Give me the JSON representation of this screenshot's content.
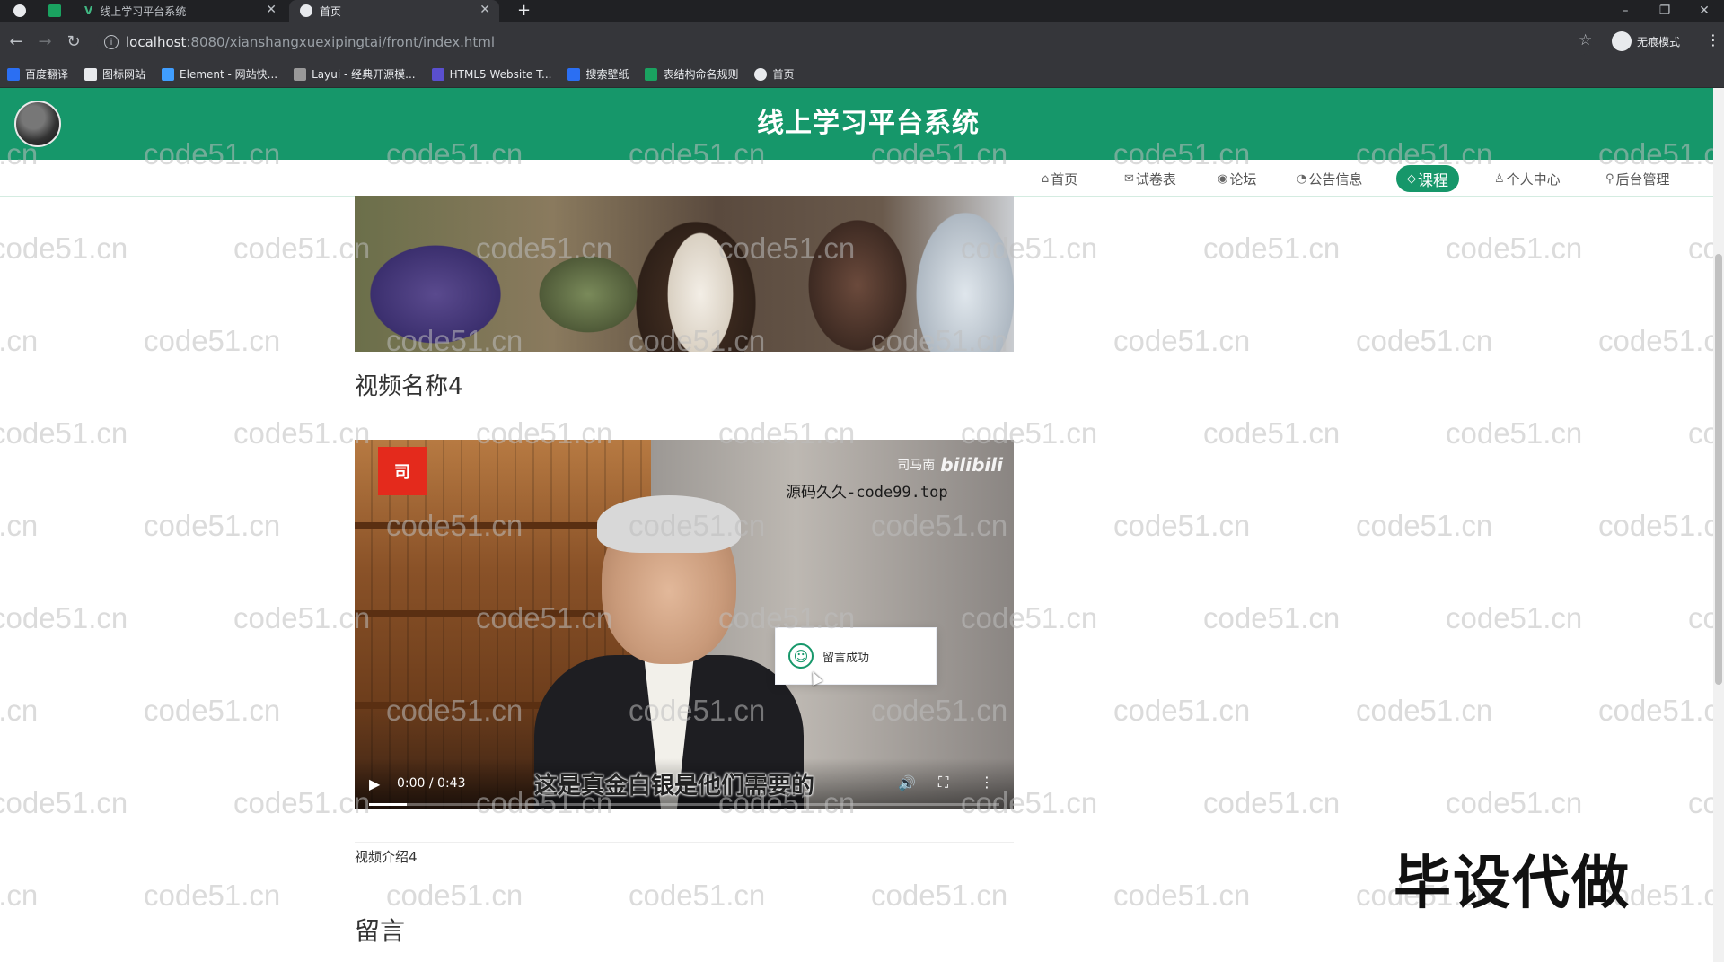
{
  "browser": {
    "tabs": [
      {
        "title": "线上学习平台系统",
        "active": false
      },
      {
        "title": "首页",
        "active": true
      }
    ],
    "new_tab": "+",
    "address": {
      "host": "localhost",
      "path": ":8080/xianshangxuexipingtai/front/index.html"
    },
    "incognito_label": "无痕模式",
    "bookmarks": [
      {
        "label": "百度翻译",
        "color": "#2b6ff3"
      },
      {
        "label": "图标网站",
        "color": "#e8eaed"
      },
      {
        "label": "Element - 网站快...",
        "color": "#409eff"
      },
      {
        "label": "Layui - 经典开源模...",
        "color": "#999999"
      },
      {
        "label": "HTML5 Website T...",
        "color": "#5a4fcf"
      },
      {
        "label": "搜索壁纸",
        "color": "#2b6ff3"
      },
      {
        "label": "表结构命名规则",
        "color": "#1aa260"
      },
      {
        "label": "首页",
        "color": "#e8eaed"
      }
    ]
  },
  "site": {
    "title": "线上学习平台系统",
    "accent_color": "#16976a",
    "nav": [
      {
        "icon": "⌂",
        "label": "首页",
        "active": false
      },
      {
        "icon": "✉",
        "label": "试卷表",
        "active": false
      },
      {
        "icon": "◉",
        "label": "论坛",
        "active": false
      },
      {
        "icon": "◔",
        "label": "公告信息",
        "active": false
      },
      {
        "icon": "◇",
        "label": "课程",
        "active": true
      },
      {
        "icon": "♙",
        "label": "个人中心",
        "active": false
      },
      {
        "icon": "⚲",
        "label": "后台管理",
        "active": false
      }
    ]
  },
  "content": {
    "video_title": "视频名称4",
    "player": {
      "logo_text": "司",
      "brand_name": "司马南",
      "brand_site": "bilibili",
      "watermark_text": "源码久久-code99.top",
      "subtitle": "这是真金白银是他们需要的",
      "time": "0:00 / 0:43",
      "progress": 0.06
    },
    "toast": "留言成功",
    "video_desc": "视频介绍4",
    "comment_heading": "留言"
  },
  "overlay": {
    "watermark": "code51.cn",
    "promo": "毕设代做"
  }
}
